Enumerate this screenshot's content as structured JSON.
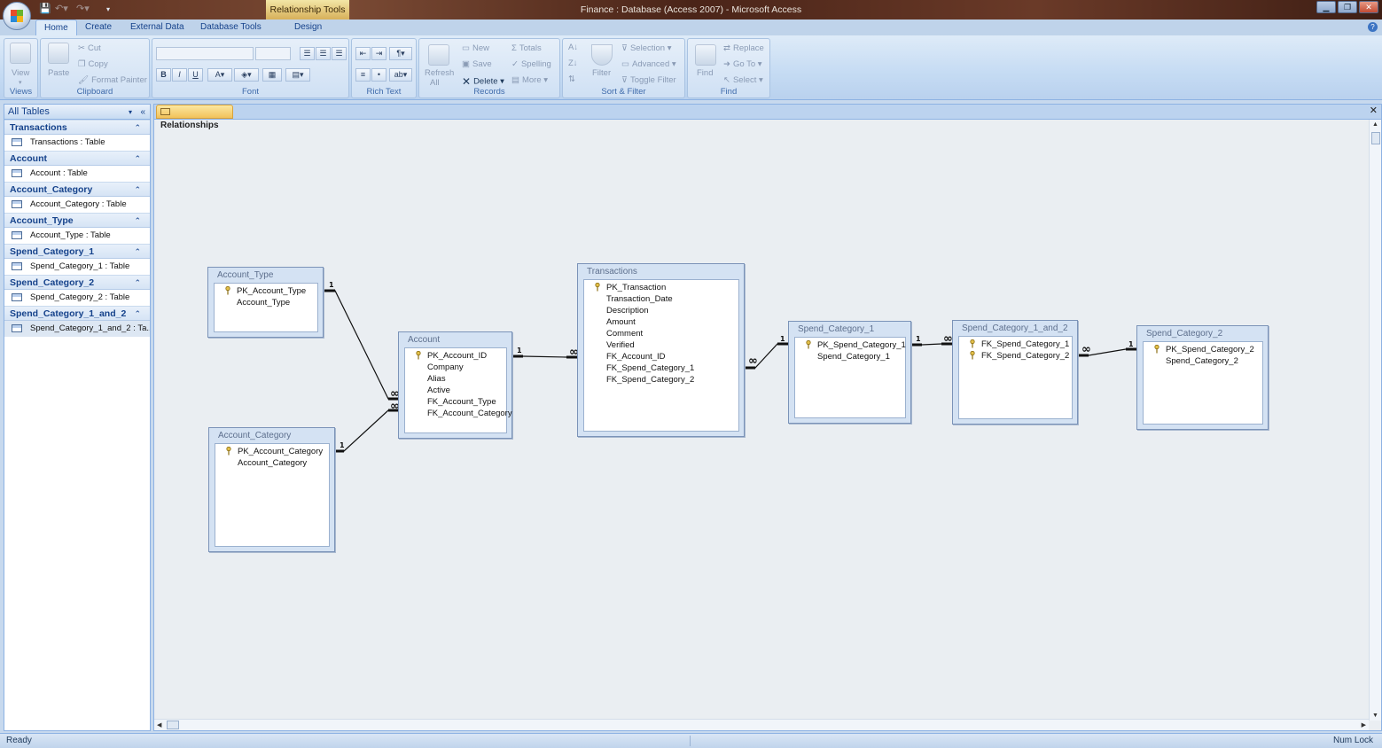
{
  "titlebar": {
    "context_tab": "Relationship Tools",
    "title": "Finance : Database (Access 2007) - Microsoft Access"
  },
  "ribbon_tabs": [
    {
      "label": "Home",
      "active": true
    },
    {
      "label": "Create"
    },
    {
      "label": "External Data"
    },
    {
      "label": "Database Tools"
    },
    {
      "label": "Design"
    }
  ],
  "ribbon": {
    "views": {
      "label": "Views",
      "view": "View"
    },
    "clipboard": {
      "label": "Clipboard",
      "paste": "Paste",
      "cut": "Cut",
      "copy": "Copy",
      "format_painter": "Format Painter"
    },
    "font": {
      "label": "Font"
    },
    "rich_text": {
      "label": "Rich Text"
    },
    "records": {
      "label": "Records",
      "refresh": "Refresh",
      "refresh2": "All",
      "new": "New",
      "save": "Save",
      "delete": "Delete",
      "totals": "Totals",
      "spelling": "Spelling",
      "more": "More"
    },
    "sort_filter": {
      "label": "Sort & Filter",
      "filter": "Filter",
      "selection": "Selection",
      "advanced": "Advanced",
      "toggle_filter": "Toggle Filter"
    },
    "find": {
      "label": "Find",
      "find": "Find",
      "replace": "Replace",
      "goto": "Go To",
      "select": "Select"
    }
  },
  "nav": {
    "header": "All Tables",
    "groups": [
      {
        "name": "Transactions",
        "item": "Transactions : Table"
      },
      {
        "name": "Account",
        "item": "Account : Table"
      },
      {
        "name": "Account_Category",
        "item": "Account_Category : Table"
      },
      {
        "name": "Account_Type",
        "item": "Account_Type : Table"
      },
      {
        "name": "Spend_Category_1",
        "item": "Spend_Category_1 : Table"
      },
      {
        "name": "Spend_Category_2",
        "item": "Spend_Category_2 : Table"
      },
      {
        "name": "Spend_Category_1_and_2",
        "item": "Spend_Category_1_and_2 : Ta..."
      }
    ]
  },
  "document": {
    "tab": "Relationships"
  },
  "tables": {
    "account_type": {
      "title": "Account_Type",
      "fields": [
        "PK_Account_Type",
        "Account_Type"
      ]
    },
    "account_category": {
      "title": "Account_Category",
      "fields": [
        "PK_Account_Category",
        "Account_Category"
      ]
    },
    "account": {
      "title": "Account",
      "fields": [
        "PK_Account_ID",
        "Company",
        "Alias",
        "Active",
        "FK_Account_Type",
        "FK_Account_Category"
      ]
    },
    "transactions": {
      "title": "Transactions",
      "fields": [
        "PK_Transaction",
        "Transaction_Date",
        "Description",
        "Amount",
        "Comment",
        "Verified",
        "FK_Account_ID",
        "FK_Spend_Category_1",
        "FK_Spend_Category_2"
      ]
    },
    "spend_category_1": {
      "title": "Spend_Category_1",
      "fields": [
        "PK_Spend_Category_1",
        "Spend_Category_1"
      ]
    },
    "spend_category_1_and_2": {
      "title": "Spend_Category_1_and_2",
      "fields": [
        "FK_Spend_Category_1",
        "FK_Spend_Category_2"
      ]
    },
    "spend_category_2": {
      "title": "Spend_Category_2",
      "fields": [
        "PK_Spend_Category_2",
        "Spend_Category_2"
      ]
    }
  },
  "relationship_labels": {
    "one": "1",
    "many": "∞"
  },
  "status": {
    "left": "Ready",
    "right": "Num Lock"
  }
}
